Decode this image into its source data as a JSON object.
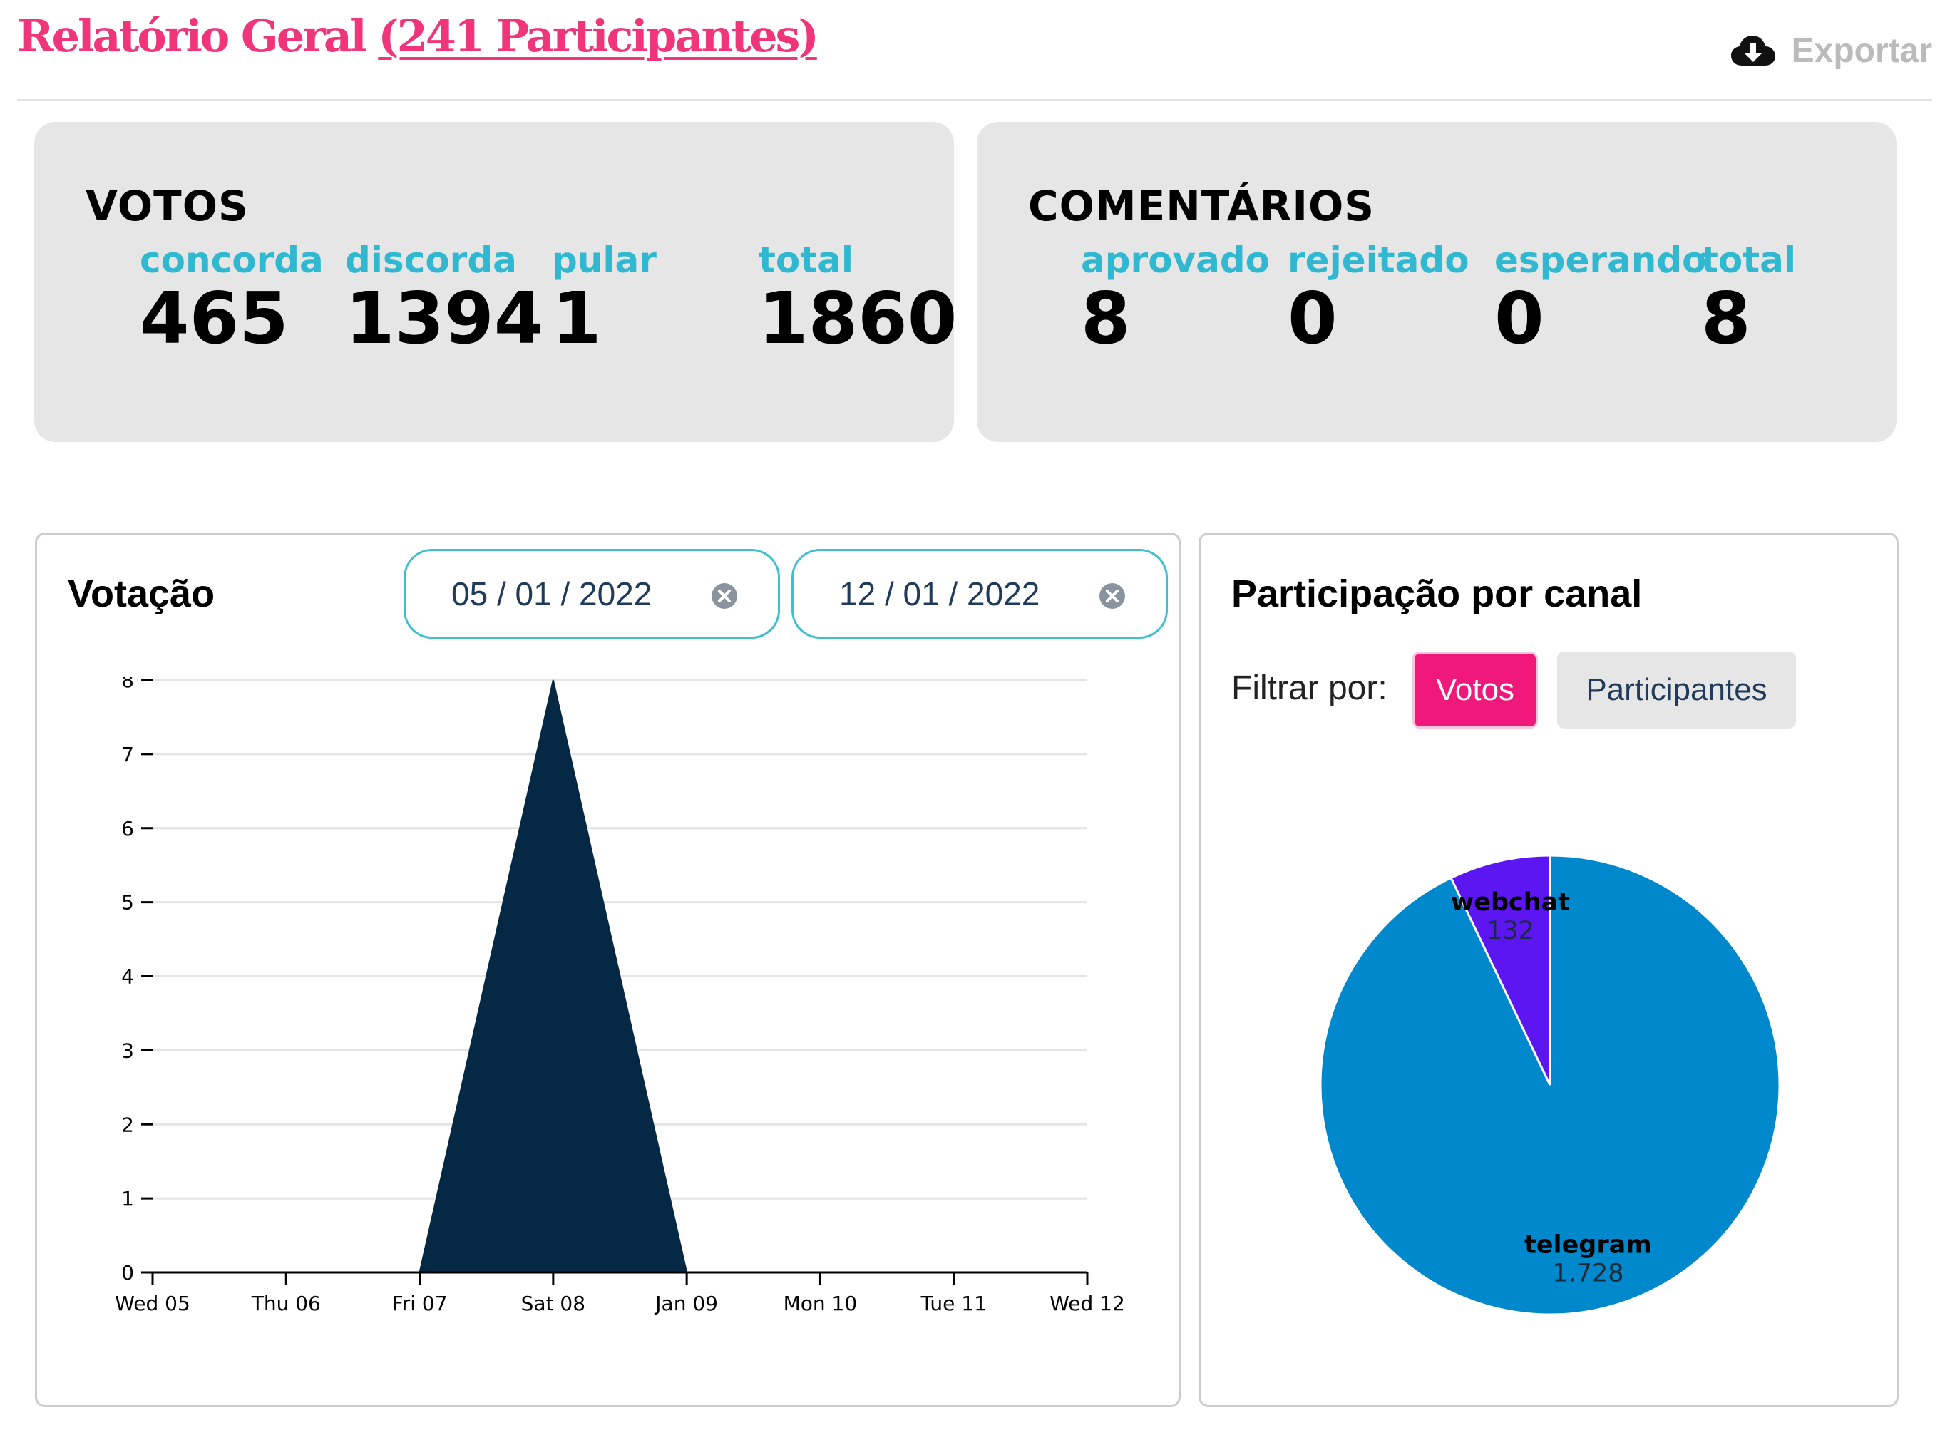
{
  "header": {
    "title_prefix": "Relatório Geral",
    "title_link": "(241 Participantes)",
    "export_label": "Exportar",
    "export_icon": "cloud-download-icon"
  },
  "votes": {
    "title": "VOTOS",
    "stats": [
      {
        "label": "concorda",
        "value": "465"
      },
      {
        "label": "discorda",
        "value": "1394"
      },
      {
        "label": "pular",
        "value": "1"
      },
      {
        "label": "total",
        "value": "1860"
      }
    ]
  },
  "comments": {
    "title": "COMENTÁRIOS",
    "stats": [
      {
        "label": "aprovado",
        "value": "8"
      },
      {
        "label": "rejeitado",
        "value": "0"
      },
      {
        "label": "esperando",
        "value": "0"
      },
      {
        "label": "total",
        "value": "8"
      }
    ]
  },
  "voting": {
    "title": "Votação",
    "start_date": "05 / 01 / 2022",
    "end_date": "12 / 01 / 2022",
    "clear_icon": "clear-icon"
  },
  "channels": {
    "title": "Participação por canal",
    "filter_label": "Filtrar por:",
    "filters": [
      {
        "label": "Votos",
        "active": true
      },
      {
        "label": "Participantes",
        "active": false
      }
    ]
  },
  "colors": {
    "brand_pink": "#f0357a",
    "accent_cyan": "#30b8d0",
    "area_fill": "#052844",
    "telegram": "#0088cc",
    "webchat": "#5c16f2"
  },
  "chart_data": [
    {
      "type": "area",
      "x": [
        "Wed 05",
        "Thu 06",
        "Fri 07",
        "Sat 08",
        "Jan 09",
        "Mon 10",
        "Tue 11",
        "Wed 12"
      ],
      "values": [
        0,
        0,
        0,
        8,
        0,
        0,
        0,
        0
      ],
      "ylim": [
        0,
        8
      ],
      "yticks": [
        0,
        1,
        2,
        3,
        4,
        5,
        6,
        7,
        8
      ],
      "grid": true
    },
    {
      "type": "pie",
      "slices": [
        {
          "label": "telegram",
          "value": 1728,
          "display": "1.728"
        },
        {
          "label": "webchat",
          "value": 132,
          "display": "132"
        }
      ]
    }
  ]
}
